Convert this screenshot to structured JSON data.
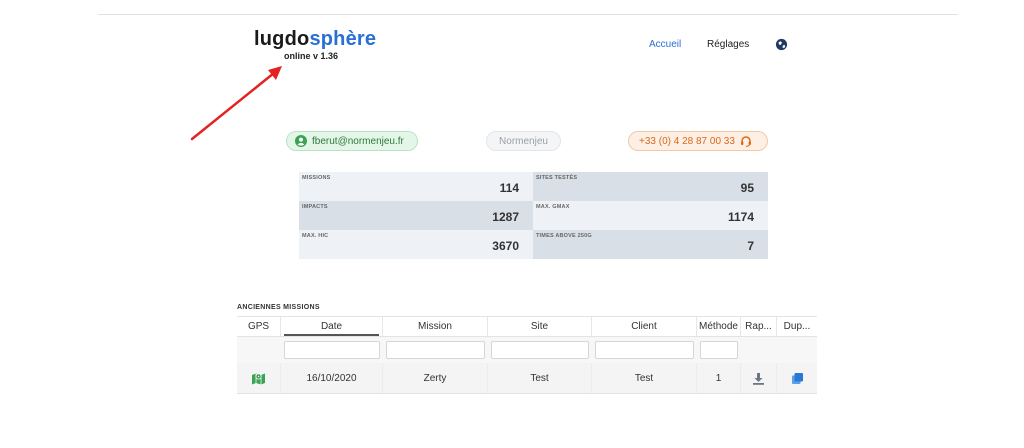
{
  "app": {
    "logo_part1": "lugdo",
    "logo_part2": "sphère",
    "version": "online v 1.36"
  },
  "nav": {
    "home": "Accueil",
    "settings": "Réglages",
    "globe_icon": "globe-icon"
  },
  "user": {
    "email": "fberut@normenjeu.fr",
    "organization": "Normenjeu",
    "phone": "+33 (0) 4 28 87 00 33"
  },
  "stats": [
    {
      "label": "MISSIONS",
      "value": "114"
    },
    {
      "label": "SITES TESTÉS",
      "value": "95"
    },
    {
      "label": "IMPACTS",
      "value": "1287"
    },
    {
      "label": "MAX. GMAX",
      "value": "1174"
    },
    {
      "label": "MAX. HIC",
      "value": "3670"
    },
    {
      "label": "TIMES ABOVE 250G",
      "value": "7"
    }
  ],
  "missions": {
    "title": "ANCIENNES MISSIONS",
    "columns": [
      "GPS",
      "Date",
      "Mission",
      "Site",
      "Client",
      "Méthode",
      "Rap...",
      "Dup..."
    ],
    "rows": [
      {
        "date": "16/10/2020",
        "mission": "Zerty",
        "site": "Test",
        "client": "Test",
        "method": "1"
      }
    ]
  },
  "colors": {
    "brand_blue": "#2a6fd6",
    "success_green": "#2c7a3c",
    "phone_orange": "#d86a1c",
    "arrow_red": "#e32222"
  }
}
